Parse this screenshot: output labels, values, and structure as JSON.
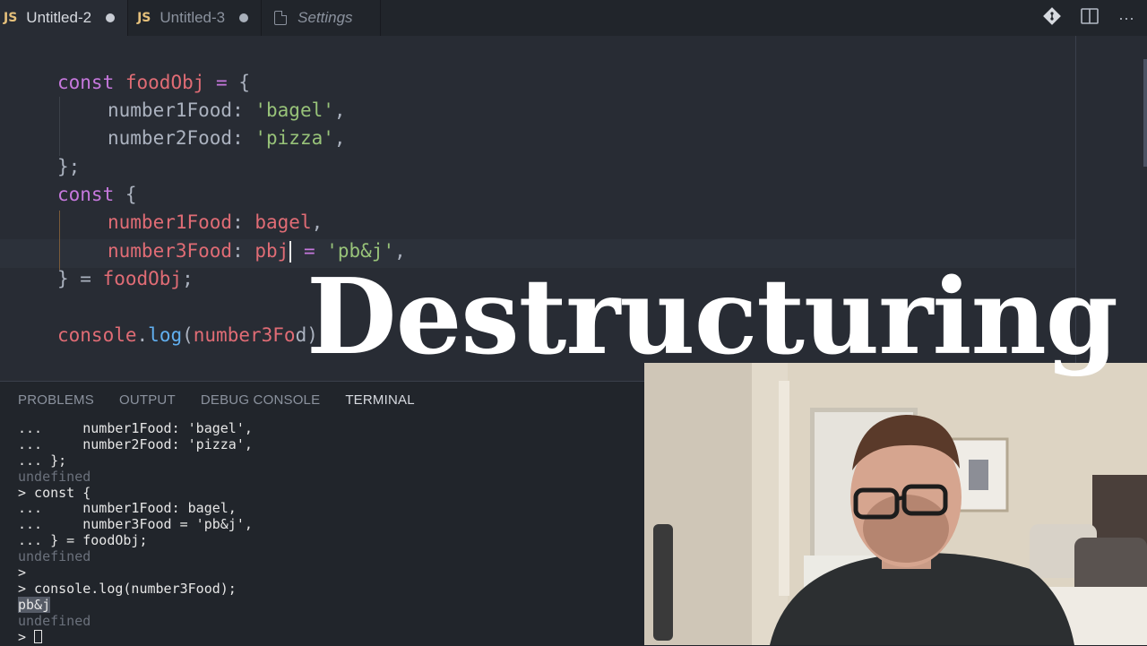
{
  "tabs": [
    {
      "badge": "JS",
      "label": "Untitled-2",
      "active": true,
      "dirty": true
    },
    {
      "badge": "JS",
      "label": "Untitled-3",
      "active": false,
      "dirty": true
    },
    {
      "badge": "",
      "label": "Settings",
      "active": false,
      "dirty": false
    }
  ],
  "tab_actions": {
    "compare_icon": "git-compare-icon",
    "split_icon": "split-editor-icon",
    "more_label": "···"
  },
  "code": {
    "l1": [
      "const",
      " ",
      "foodObj",
      " ",
      "=",
      " {"
    ],
    "l2": [
      "number1Food",
      ": ",
      "'bagel'",
      ","
    ],
    "l3": [
      "number2Food",
      ": ",
      "'pizza'",
      ","
    ],
    "l4": "};",
    "l5": [
      "const",
      " {"
    ],
    "l6": [
      "number1Food",
      ": ",
      "bagel",
      ","
    ],
    "l7": [
      "number3Food",
      ": ",
      "pbj",
      " = ",
      "'pb&j'",
      ","
    ],
    "l8": [
      "} = ",
      "foodObj",
      ";"
    ],
    "l9": [
      "console",
      ".",
      "log",
      "(",
      "number3Fo",
      "d)"
    ]
  },
  "panel": {
    "tabs": [
      "PROBLEMS",
      "OUTPUT",
      "DEBUG CONSOLE",
      "TERMINAL"
    ],
    "active_tab": "TERMINAL"
  },
  "terminal": {
    "lines": [
      "...     number1Food: 'bagel',",
      "...     number2Food: 'pizza',",
      "... };",
      "undefined",
      "> const {",
      "...     number1Food: bagel,",
      "...     number3Food = 'pb&j',",
      "... } = foodObj;",
      "undefined",
      ">",
      "> console.log(number3Food);",
      "pb&j",
      "undefined",
      "> "
    ]
  },
  "overlay": {
    "title": "Destructuring"
  },
  "colors": {
    "keyword": "#c678dd",
    "variable": "#e06c75",
    "string": "#98c379",
    "function": "#61afef",
    "editor_bg": "#282c34",
    "panel_bg": "#21252b"
  }
}
